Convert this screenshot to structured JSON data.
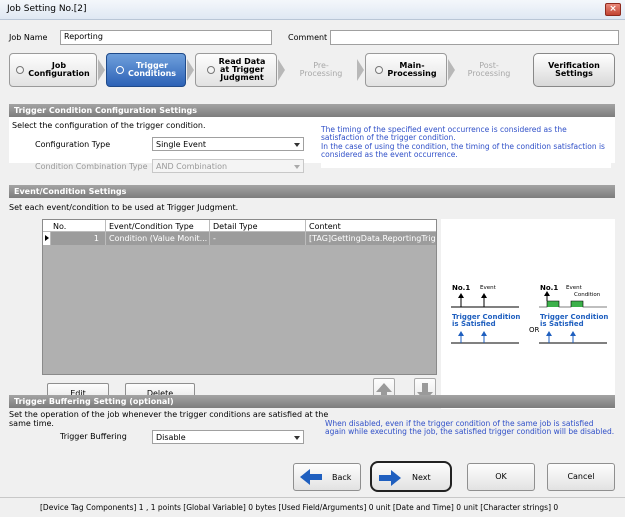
{
  "window": {
    "title": "Job Setting No.[2]",
    "close_glyph": "×"
  },
  "job": {
    "name_label": "Job Name",
    "name_value": "Reporting",
    "comment_label": "Comment",
    "comment_value": ""
  },
  "steps": [
    {
      "label": "Job\nConfiguration",
      "state": "done"
    },
    {
      "label": "Trigger\nConditions",
      "state": "current"
    },
    {
      "label": "Read Data\nat Trigger\nJudgment",
      "state": "done"
    },
    {
      "label": "Pre-\nProcessing",
      "state": "disabled"
    },
    {
      "label": "Main-\nProcessing",
      "state": "done"
    },
    {
      "label": "Post-\nProcessing",
      "state": "disabled"
    },
    {
      "label": "Verification\nSettings",
      "state": "pill"
    }
  ],
  "trigger_config": {
    "header": "Trigger Condition Configuration Settings",
    "instruction": "Select the configuration of the trigger condition.",
    "config_type_label": "Configuration Type",
    "config_type_value": "Single Event",
    "combination_label": "Condition Combination Type",
    "combination_value": "AND Combination",
    "info": "The timing of the specified event occurrence is considered as the satisfaction of the trigger condition.\nIn the case of using the condition, the timing of the condition satisfaction is considered as the event occurrence."
  },
  "event_settings": {
    "header": "Event/Condition Settings",
    "instruction": "Set each event/condition to be used at Trigger Judgment.",
    "columns": [
      "No.",
      "Event/Condition Type",
      "Detail Type",
      "Content"
    ],
    "rows": [
      {
        "no": "1",
        "type": "Condition (Value Monit...",
        "detail": "-",
        "content": "[TAG]GettingData.ReportingTrig..."
      }
    ],
    "edit_button": "Edit",
    "delete_button": "Delete"
  },
  "diagram": {
    "left_no": "No.1",
    "left_event": "Event",
    "left_satisfied": "Trigger Condition\nis Satisfied",
    "or": "OR",
    "right_no": "No.1",
    "right_event": "Event",
    "right_condition": "Condition",
    "right_satisfied": "Trigger Condition\nis Satisfied"
  },
  "buffering": {
    "header": "Trigger Buffering Setting (optional)",
    "instruction": "Set the operation of the job whenever the trigger conditions are satisfied at the same time.",
    "label": "Trigger Buffering",
    "value": "Disable",
    "info": "When disabled, even if the trigger condition of the same job is satisfied again while executing the job, the satisfied trigger condition will be disabled."
  },
  "nav": {
    "back": "Back",
    "next": "Next",
    "ok": "OK",
    "cancel": "Cancel"
  },
  "status_bar": "[Device Tag Components]  1 ,   1 points  [Global Variable]  0 bytes  [Used Field/Arguments]  0 unit  [Date and Time]  0 unit  [Character strings]  0",
  "colors": {
    "info_text": "#3050c8",
    "current_step": "#2d62b6",
    "arrow_blue": "#1f5fbf",
    "condition_green": "#3cb04a"
  }
}
